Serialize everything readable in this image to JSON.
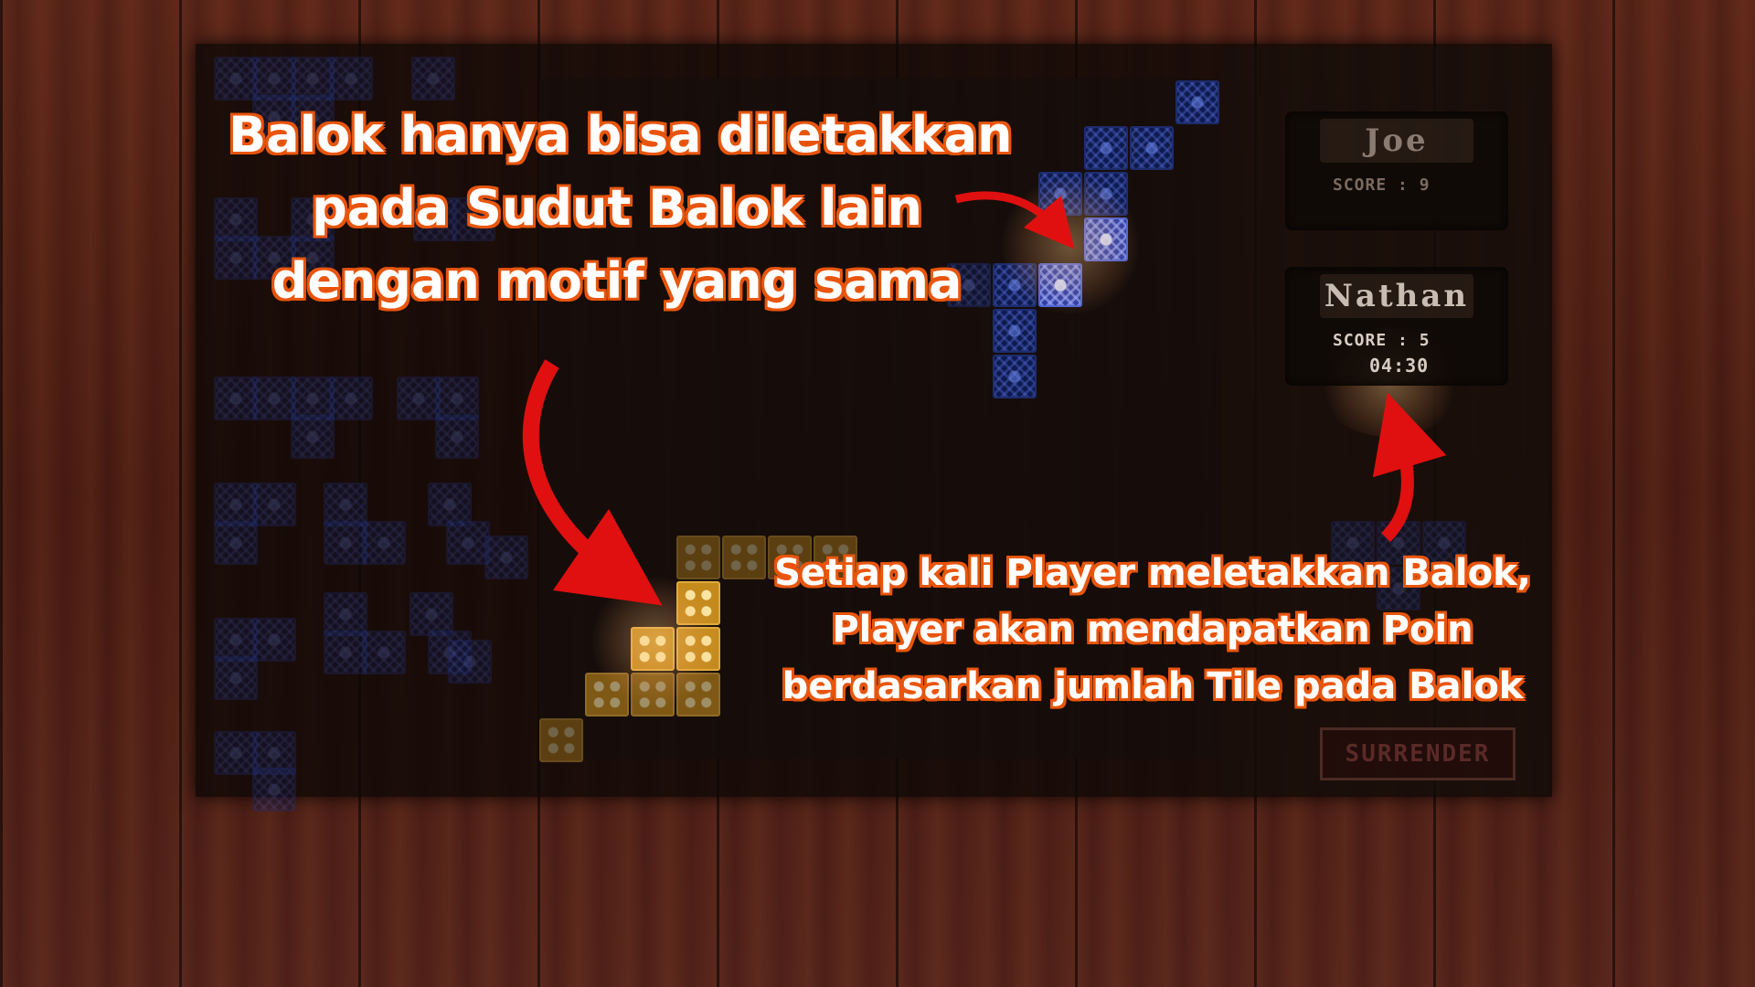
{
  "callouts": {
    "top": [
      "Balok hanya bisa diletakkan",
      "pada Sudut Balok lain",
      "dengan motif yang sama"
    ],
    "bottom": [
      "Setiap kali Player meletakkan Balok,",
      "Player akan mendapatkan Poin",
      "berdasarkan jumlah Tile pada Balok"
    ]
  },
  "players": [
    {
      "name": "Joe",
      "score_text": "SCORE : 9",
      "active": false
    },
    {
      "name": "Nathan",
      "score_text": "SCORE : 5",
      "timer": "04:30",
      "active": true
    }
  ],
  "surrender_label": "SURRENDER",
  "colors": {
    "callout_outline": "#e8550c",
    "arrow": "#e01010",
    "blue_tile": "#0d1a4e",
    "gold_tile": "#c48a1c"
  }
}
